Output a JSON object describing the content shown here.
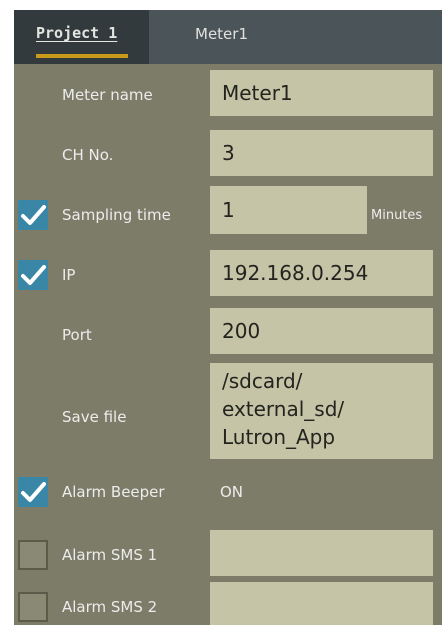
{
  "tabs": {
    "active_label": "Project 1",
    "second_label": "Meter1"
  },
  "rows": {
    "meter_name": {
      "label": "Meter name",
      "value": "Meter1"
    },
    "ch_no": {
      "label": "CH No.",
      "value": "3"
    },
    "sampling_time": {
      "label": "Sampling time",
      "value": "1",
      "unit": "Minutes",
      "checked": true
    },
    "ip": {
      "label": "IP",
      "value": "192.168.0.254",
      "checked": true
    },
    "port": {
      "label": "Port",
      "value": "200"
    },
    "save_file": {
      "label": "Save file",
      "line1": "/sdcard/",
      "line2": "external_sd/",
      "line3": "Lutron_App"
    },
    "alarm_beeper": {
      "label": "Alarm Beeper",
      "value": "ON",
      "checked": true
    },
    "alarm_sms_1": {
      "label": "Alarm SMS 1",
      "value": "",
      "checked": false
    },
    "alarm_sms_2": {
      "label": "Alarm SMS 2",
      "value": "",
      "checked": false
    }
  },
  "colors": {
    "panel_bg": "#7d7c69",
    "field_bg": "#c6c4a6",
    "check_blue": "#3a86a6",
    "tab_underline": "#c99a1a"
  },
  "icons": {
    "checkbox_checked": "check-icon"
  }
}
